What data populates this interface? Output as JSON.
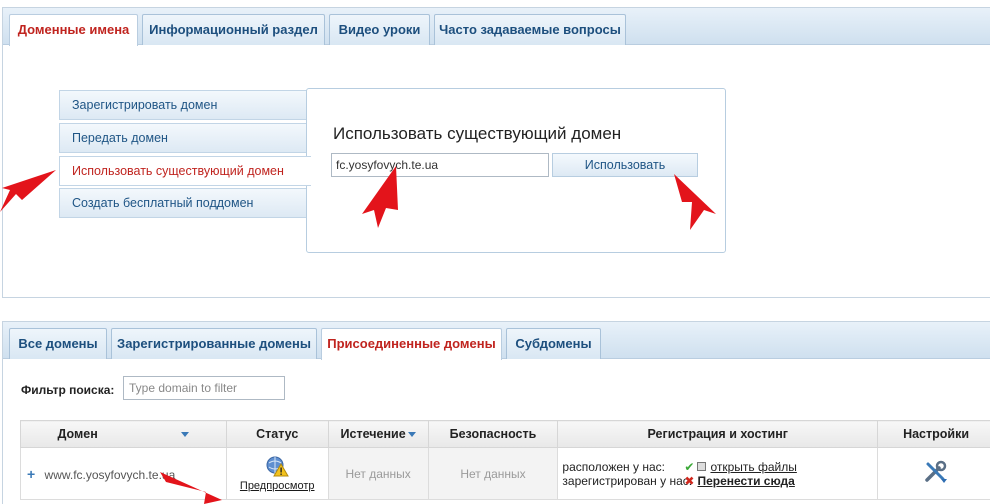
{
  "top_tabs": [
    {
      "label": "Доменные имена"
    },
    {
      "label": "Информационный раздел"
    },
    {
      "label": "Видео уроки"
    },
    {
      "label": "Часто задаваемые вопросы"
    }
  ],
  "sidebar": {
    "items": [
      {
        "label": "Зарегистрировать домен"
      },
      {
        "label": "Передать домен"
      },
      {
        "label": "Использовать существующий домен"
      },
      {
        "label": "Создать бесплатный поддомен"
      }
    ]
  },
  "form": {
    "title": "Использовать существующий домен",
    "domain_value": "fc.yosyfovych.te.ua",
    "submit_label": "Использовать"
  },
  "bottom_tabs": [
    {
      "label": "Все домены"
    },
    {
      "label": "Зарегистрированные домены"
    },
    {
      "label": "Присоединенные домены"
    },
    {
      "label": "Субдомены"
    }
  ],
  "filter": {
    "label": "Фильтр поиска:",
    "placeholder": "Type domain to filter"
  },
  "table": {
    "headers": [
      "Домен",
      "Статус",
      "Истечение",
      "Безопасность",
      "Регистрация и хостинг",
      "Настройки"
    ],
    "rows": [
      {
        "domain_prefix": "www.",
        "domain": "fc.yosyfovych.te.ua",
        "status_link": "Предпросмотр",
        "expiry": "Нет данных",
        "security": "Нет данных",
        "hosted_label": "расположен у нас:",
        "hosted_link": "открыть файлы",
        "registered_label": "зарегистрирован у нас:",
        "registered_link": "Перенести сюда"
      }
    ]
  },
  "colors": {
    "active_tab": "#c0241f",
    "link_blue": "#1f5585",
    "annotation_arrow": "#e3141b"
  },
  "icons": [
    "plus-icon",
    "preview-warning-icon",
    "check-icon",
    "file-icon",
    "cross-icon",
    "settings-tools-icon",
    "sort-arrow-icon"
  ]
}
